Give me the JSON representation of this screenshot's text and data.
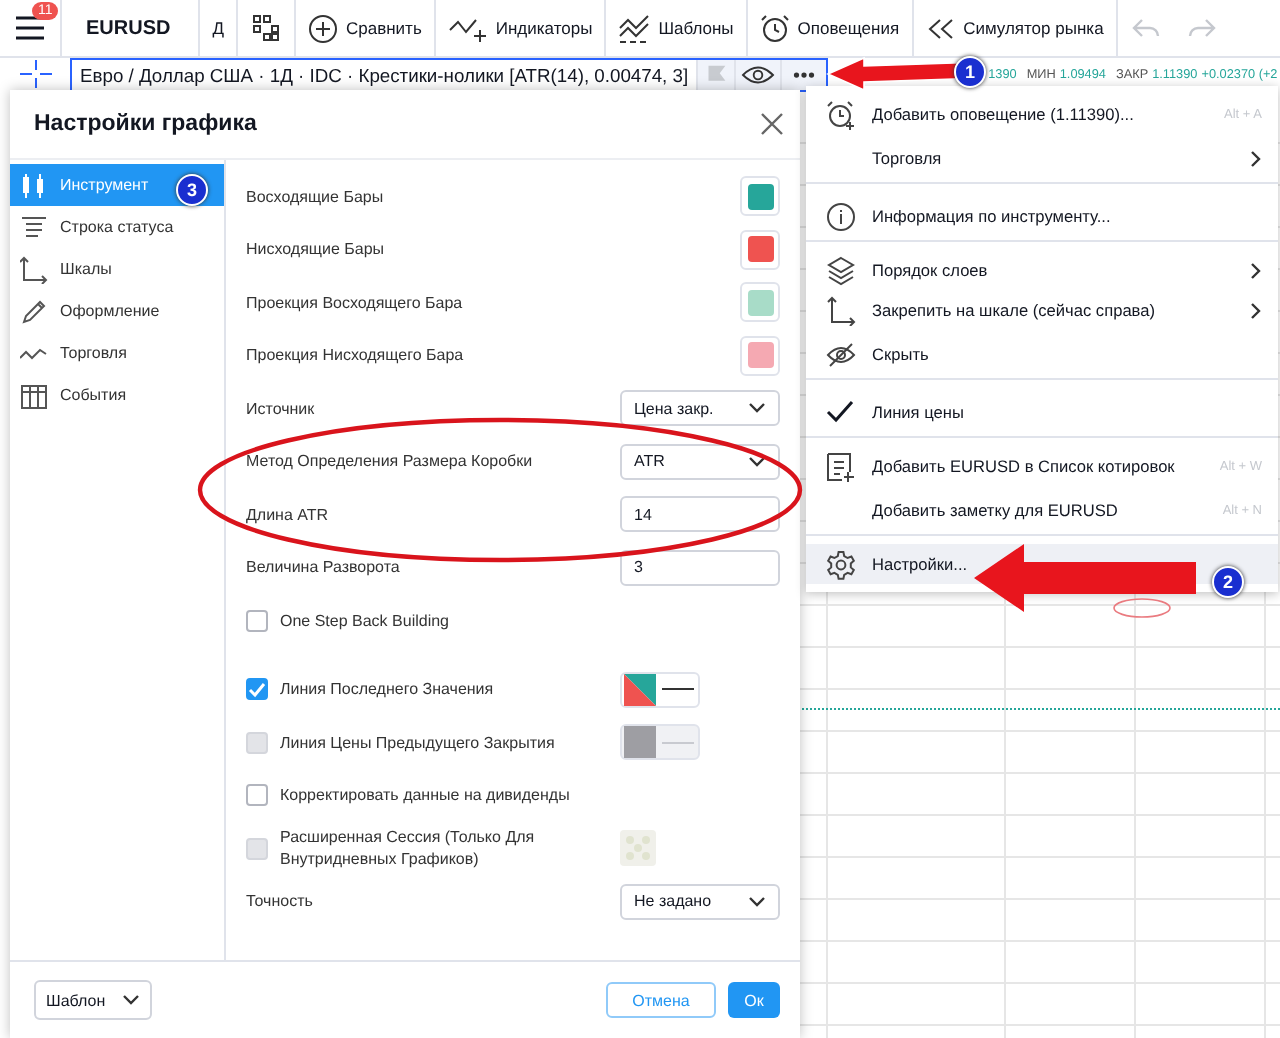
{
  "toolbar": {
    "notifications": "11",
    "symbol": "EURUSD",
    "interval": "Д",
    "buttons": [
      {
        "label": "Сравнить"
      },
      {
        "label": "Индикаторы"
      },
      {
        "label": "Шаблоны"
      },
      {
        "label": "Оповещения"
      },
      {
        "label": "Симулятор рынка"
      }
    ]
  },
  "legend": {
    "title": "Евро / Доллар США · 1Д · IDC · Крестики-нолики [ATR(14), 0.00474, 3]",
    "partial_value": "1390",
    "ohlc": [
      {
        "label": "МИН",
        "value": "1.09494"
      },
      {
        "label": "ЗАКР",
        "value": "1.11390"
      }
    ],
    "change": "+0.02370 (+2"
  },
  "dialog": {
    "title": "Настройки графика",
    "tabs": [
      {
        "label": "Инструмент",
        "selected": true
      },
      {
        "label": "Строка статуса",
        "selected": false
      },
      {
        "label": "Шкалы",
        "selected": false
      },
      {
        "label": "Оформление",
        "selected": false
      },
      {
        "label": "Торговля",
        "selected": false
      },
      {
        "label": "События",
        "selected": false
      }
    ],
    "rows": [
      {
        "kind": "color",
        "label": "Восходящие Бары",
        "color": "#26a69a"
      },
      {
        "kind": "color",
        "label": "Нисходящие Бары",
        "color": "#ef5350"
      },
      {
        "kind": "color",
        "label": "Проекция Восходящего Бара",
        "color": "#a8dcc8"
      },
      {
        "kind": "color",
        "label": "Проекция Нисходящего Бара",
        "color": "#f5a9b2"
      },
      {
        "kind": "select",
        "label": "Источник",
        "value": "Цена закр."
      },
      {
        "kind": "select",
        "label": "Метод Определения Размера Коробки",
        "value": "ATR"
      },
      {
        "kind": "input",
        "label": "Длина ATR",
        "value": "14"
      },
      {
        "kind": "input",
        "label": "Величина Разворота",
        "value": "3"
      },
      {
        "kind": "checkbox",
        "label": "One Step Back Building",
        "checked": false,
        "disabled": false
      },
      {
        "kind": "spacer"
      },
      {
        "kind": "checkbox-line",
        "label": "Линия Последнего Значения",
        "checked": true,
        "disabled": false
      },
      {
        "kind": "checkbox-line",
        "label": "Линия Цены Предыдущего Закрытия",
        "checked": false,
        "disabled": true
      },
      {
        "kind": "checkbox",
        "label": "Корректировать данные на дивиденды",
        "checked": false,
        "disabled": false
      },
      {
        "kind": "checkbox-pattern",
        "label": "Расширенная Сессия (Только Для Внутридневных Графиков)",
        "checked": false,
        "disabled": true
      },
      {
        "kind": "select",
        "label": "Точность",
        "value": "Не задано"
      }
    ],
    "template": "Шаблон",
    "cancel": "Отмена",
    "ok": "Ок"
  },
  "menu": [
    {
      "label": "Добавить оповещение (1.11390)...",
      "shortcut": "Alt + A",
      "submenu": false,
      "checked": false,
      "highlighted": false,
      "separator_after": false
    },
    {
      "label": "Торговля",
      "submenu": true,
      "checked": false,
      "highlighted": false,
      "separator_after": true
    },
    {
      "label": "Информация по инструменту...",
      "submenu": false,
      "checked": false,
      "highlighted": false,
      "separator_after": true
    },
    {
      "label": "Порядок слоев",
      "submenu": true,
      "checked": false,
      "highlighted": false,
      "separator_after": false
    },
    {
      "label": "Закрепить на шкале (сейчас справа)",
      "submenu": true,
      "checked": false,
      "highlighted": false,
      "separator_after": false
    },
    {
      "label": "Скрыть",
      "submenu": false,
      "checked": false,
      "highlighted": false,
      "separator_after": true
    },
    {
      "label": "Линия цены",
      "submenu": false,
      "checked": true,
      "highlighted": false,
      "separator_after": true
    },
    {
      "label": "Добавить EURUSD в Список котировок",
      "shortcut": "Alt + W",
      "submenu": false,
      "checked": false,
      "highlighted": false,
      "separator_after": false
    },
    {
      "label": "Добавить заметку для EURUSD",
      "shortcut": "Alt + N",
      "submenu": false,
      "checked": false,
      "highlighted": false,
      "separator_after": true
    },
    {
      "label": "Настройки...",
      "submenu": false,
      "checked": false,
      "highlighted": true,
      "separator_after": false
    }
  ],
  "annotations": {
    "steps": [
      "1",
      "2",
      "3"
    ]
  }
}
